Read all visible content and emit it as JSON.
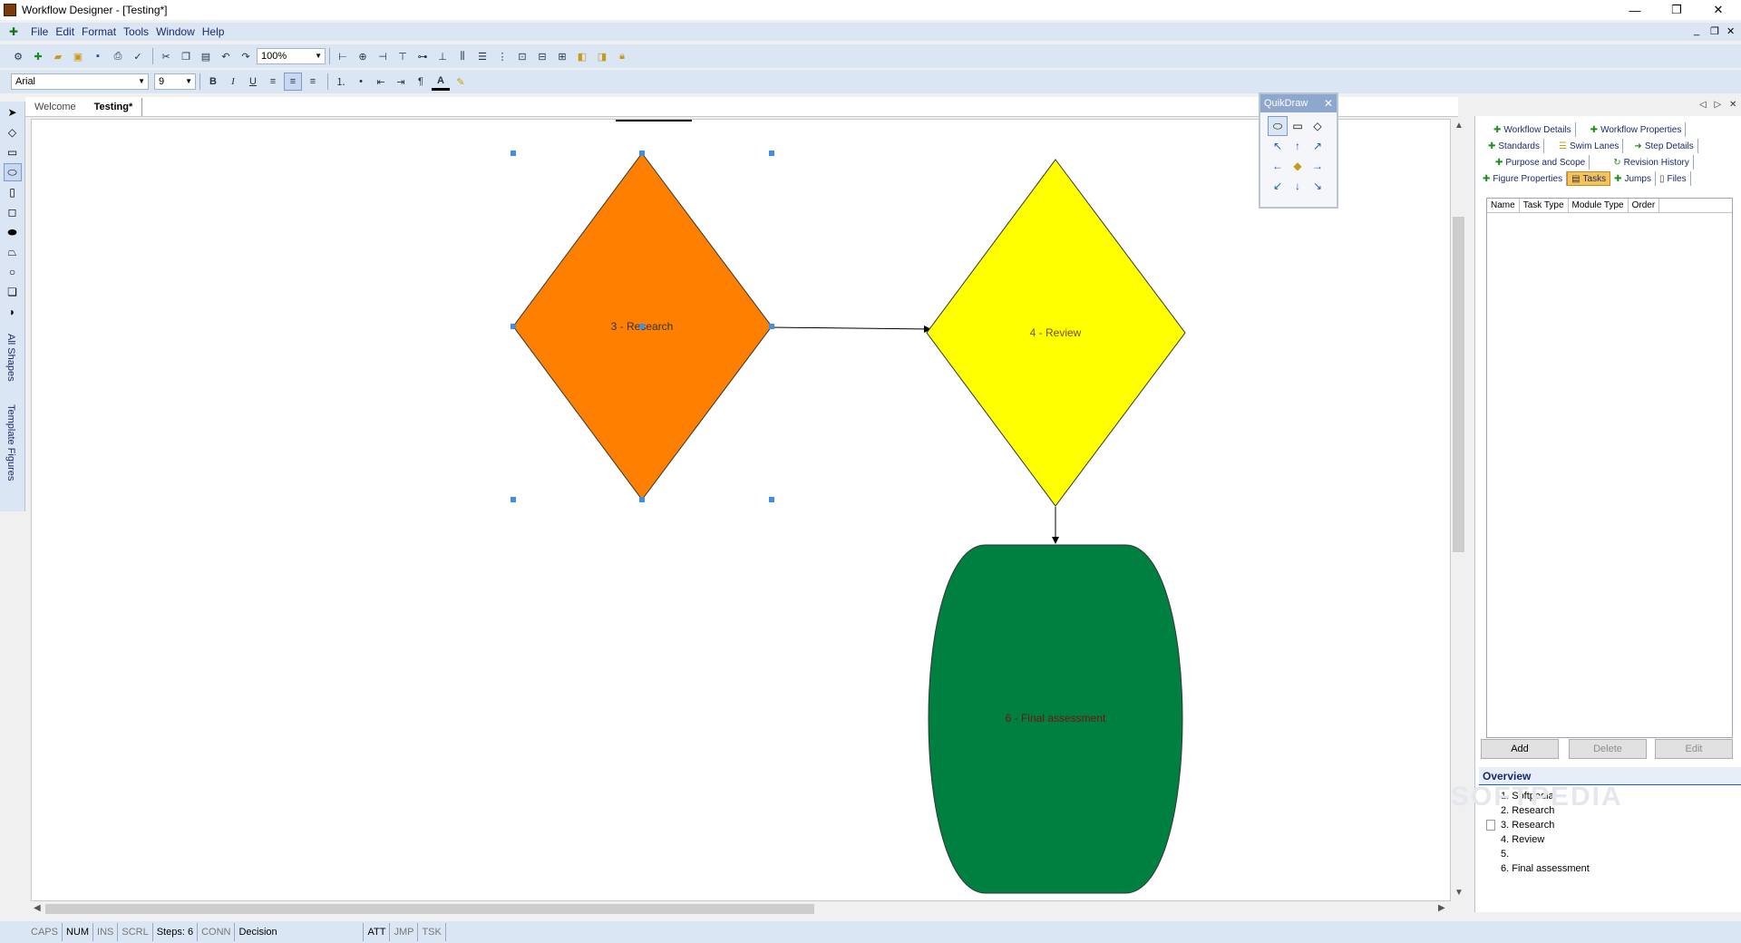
{
  "window": {
    "title": "Workflow Designer - [Testing*]",
    "controls": [
      "—",
      "❐",
      "✕"
    ],
    "mdi_controls": [
      "_",
      "❐",
      "✕"
    ]
  },
  "menu": [
    "File",
    "Edit",
    "Format",
    "Tools",
    "Window",
    "Help"
  ],
  "toolbar": {
    "zoom": "100%",
    "font": "Arial",
    "font_size": "9",
    "bold": "B",
    "italic": "I",
    "underline": "U",
    "text_color": "A"
  },
  "toolbox": {
    "all_shapes": "All Shapes",
    "template_figures": "Template Figures"
  },
  "doc_tabs": [
    "Welcome",
    "Testing*"
  ],
  "diagram": {
    "shapes": [
      {
        "label": "3 - Research",
        "shape": "diamond",
        "color": "#ff8000"
      },
      {
        "label": "4 - Review",
        "shape": "diamond",
        "color": "#ffff00"
      },
      {
        "label": "6 - Final assessment",
        "shape": "oval",
        "color": "#008040"
      }
    ]
  },
  "quikdraw": {
    "title": "QuikDraw",
    "close": "✕"
  },
  "panel": {
    "tabs_row1": [
      "Workflow Details",
      "Workflow Properties"
    ],
    "tabs_row2": [
      "Standards",
      "Swim Lanes",
      "Step Details"
    ],
    "tabs_row3": [
      "Purpose and Scope",
      "Revision History"
    ],
    "tabs_row4": [
      "Figure Properties",
      "Tasks",
      "Jumps",
      "Files"
    ],
    "columns": [
      "Name",
      "Task Type",
      "Module Type",
      "Order"
    ],
    "buttons": {
      "add": "Add",
      "delete": "Delete",
      "edit": "Edit"
    }
  },
  "overview": {
    "title": "Overview",
    "items": [
      "1. Softpedia",
      "2. Research",
      "3. Research",
      "4. Review",
      "5.",
      "6. Final assessment"
    ]
  },
  "statusbar": {
    "caps": "CAPS",
    "num": "NUM",
    "ins": "INS",
    "scrl": "SCRL",
    "steps": "Steps: 6",
    "conn": "CONN",
    "type": "Decision",
    "att": "ATT",
    "jmp": "JMP",
    "tsk": "TSK"
  },
  "watermark": "SOFTPEDIA"
}
